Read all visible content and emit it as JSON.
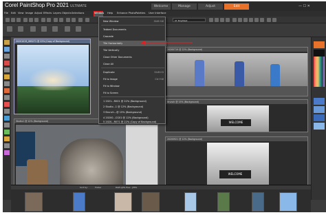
{
  "app": {
    "name": "Corel PaintShop Pro 2021",
    "edition": "ULTIMATE"
  },
  "workspace_tabs": [
    "Welcome",
    "Manage",
    "Adjust",
    "Edit"
  ],
  "active_tab": "Edit",
  "menus": [
    "File",
    "Edit",
    "View",
    "Image",
    "Adjust",
    "Effects",
    "Layers",
    "Objects",
    "Selections",
    "Window",
    "Help",
    "Enhance Photo",
    "Palettes",
    "User Interface"
  ],
  "highlighted_menu": "Window",
  "toolbar_dropdown": "ST Brightest",
  "window_menu": {
    "items": [
      {
        "label": "New Window",
        "shortcut": "Shift+W"
      },
      {
        "label": "Tabbed Documents",
        "shortcut": ""
      },
      {
        "label": "Cascade",
        "shortcut": ""
      },
      {
        "label": "Tile Horizontally",
        "shortcut": ""
      },
      {
        "label": "Tile Vertically",
        "shortcut": ""
      },
      {
        "label": "Close Other Documents",
        "shortcut": ""
      },
      {
        "label": "Close All",
        "shortcut": ""
      },
      {
        "label": "Duplicate",
        "shortcut": "Shift+D"
      },
      {
        "label": "Fit to Image",
        "shortcut": "Ctrl+W"
      },
      {
        "label": "Fit to Window",
        "shortcut": ""
      },
      {
        "label": "Fit to Screen",
        "shortcut": ""
      },
      {
        "label": "1 2021...R001 @ 22% (Background)",
        "shortcut": ""
      },
      {
        "label": "2 Studio...1 @ 12% (Background)",
        "shortcut": ""
      },
      {
        "label": "3 Brunch...@ 15% (Background)",
        "shortcut": ""
      },
      {
        "label": "4 20200...CG01 @ 12% (Background)",
        "shortcut": ""
      },
      {
        "label": "5 2020...R071 @ 22% (Copy of Background)",
        "shortcut": ""
      }
    ],
    "highlighted": "Tile Horizontally"
  },
  "documents": [
    {
      "title": "20201019_065271 @ 22% (Copy of Background)"
    },
    {
      "title": "Studio1 @ 12% (Background)"
    },
    {
      "title": "20200719 @ 22% (Background)"
    },
    {
      "title": "Brunch @ 15% (Background)"
    },
    {
      "title": "20200921 @ 12% (Background)"
    }
  ],
  "sign_text": "WELCOME",
  "organizer": {
    "sort_label": "Sort by:",
    "folder_label": "Folder",
    "info": "RAW+JPG files - JPEG"
  },
  "colors": {
    "accent": "#e8722a",
    "highlight_box": "#e02020"
  }
}
